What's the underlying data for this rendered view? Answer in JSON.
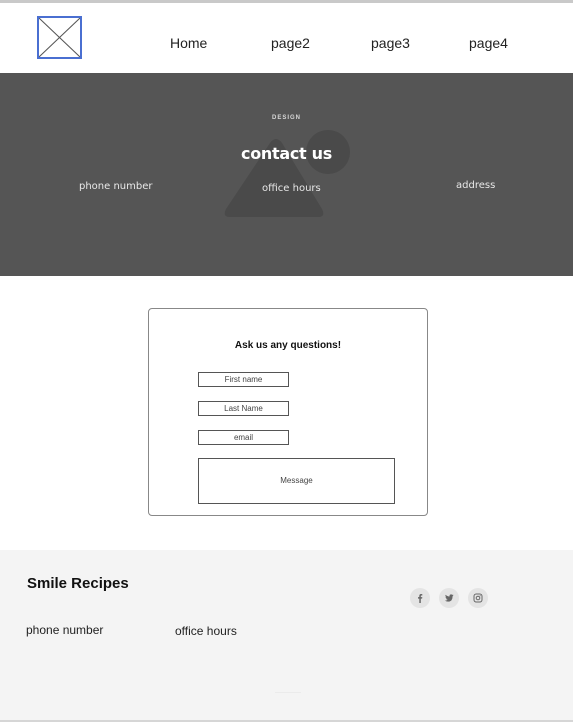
{
  "nav": {
    "items": [
      {
        "label": "Home"
      },
      {
        "label": "page2"
      },
      {
        "label": "page3"
      },
      {
        "label": "page4"
      }
    ]
  },
  "hero": {
    "eyebrow": "DESIGN",
    "title": "contact us",
    "phone": "phone number",
    "hours": "office hours",
    "address": "address",
    "background_color": "#555555"
  },
  "form": {
    "heading": "Ask us any questions!",
    "first_name": {
      "placeholder": "First name",
      "value": ""
    },
    "last_name": {
      "placeholder": "Last Name",
      "value": ""
    },
    "email": {
      "placeholder": "email",
      "value": ""
    },
    "message": {
      "placeholder": "Message",
      "value": ""
    }
  },
  "footer": {
    "brand": "Smile Recipes",
    "phone": "phone number",
    "hours": "office hours",
    "social": [
      {
        "icon": "facebook-icon"
      },
      {
        "icon": "twitter-icon"
      },
      {
        "icon": "instagram-icon"
      }
    ]
  },
  "colors": {
    "logo_border": "#4a6fd1",
    "footer_bg": "#f4f4f4"
  }
}
